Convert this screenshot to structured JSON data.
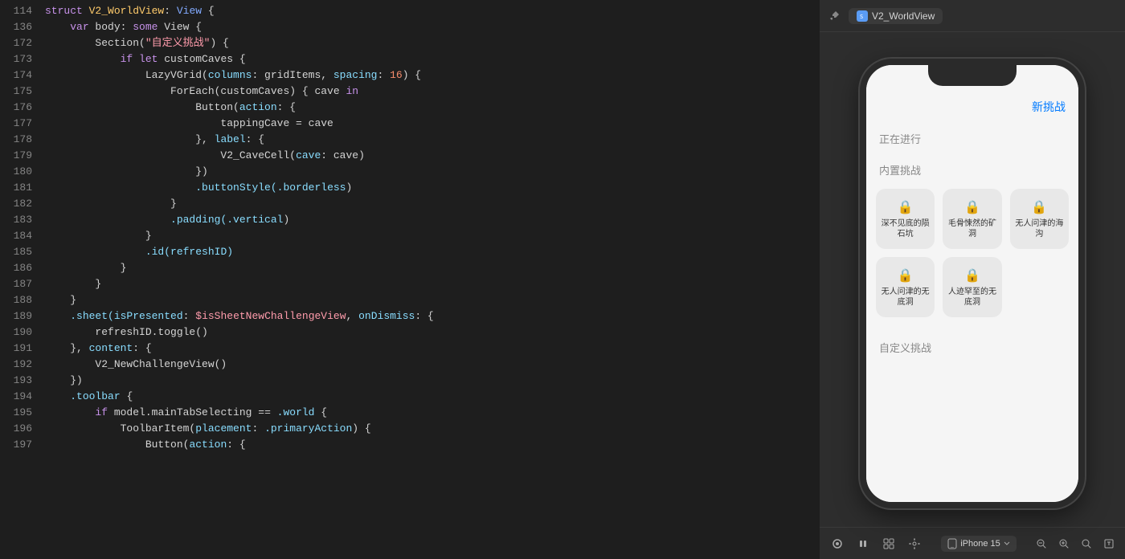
{
  "editor": {
    "lines": [
      {
        "num": "114",
        "content": [
          {
            "text": "struct ",
            "cls": "kw-keyword"
          },
          {
            "text": "V2_WorldView",
            "cls": "kw-struct"
          },
          {
            "text": ": ",
            "cls": "plain"
          },
          {
            "text": "View",
            "cls": "kw-type"
          },
          {
            "text": " {",
            "cls": "plain"
          }
        ]
      },
      {
        "num": "136",
        "content": [
          {
            "text": "    ",
            "cls": "plain"
          },
          {
            "text": "var",
            "cls": "kw-keyword"
          },
          {
            "text": " body: ",
            "cls": "plain"
          },
          {
            "text": "some",
            "cls": "kw-keyword"
          },
          {
            "text": " View {",
            "cls": "plain"
          }
        ]
      },
      {
        "num": "172",
        "content": [
          {
            "text": "        Section(",
            "cls": "plain"
          },
          {
            "text": "\"自定义挑战\"",
            "cls": "kw-string"
          },
          {
            "text": ") {",
            "cls": "plain"
          }
        ]
      },
      {
        "num": "173",
        "content": [
          {
            "text": "            ",
            "cls": "plain"
          },
          {
            "text": "if",
            "cls": "kw-keyword"
          },
          {
            "text": " ",
            "cls": "plain"
          },
          {
            "text": "let",
            "cls": "kw-keyword"
          },
          {
            "text": " customCaves {",
            "cls": "plain"
          }
        ]
      },
      {
        "num": "174",
        "content": [
          {
            "text": "                LazyVGrid(",
            "cls": "plain"
          },
          {
            "text": "columns",
            "cls": "kw-param"
          },
          {
            "text": ": gridItems, ",
            "cls": "plain"
          },
          {
            "text": "spacing",
            "cls": "kw-param"
          },
          {
            "text": ": ",
            "cls": "plain"
          },
          {
            "text": "16",
            "cls": "kw-number"
          },
          {
            "text": ") {",
            "cls": "plain"
          }
        ]
      },
      {
        "num": "175",
        "content": [
          {
            "text": "                    ForEach(customCaves) { cave ",
            "cls": "plain"
          },
          {
            "text": "in",
            "cls": "kw-keyword"
          },
          {
            "text": "",
            "cls": "plain"
          }
        ]
      },
      {
        "num": "176",
        "content": [
          {
            "text": "                        Button(",
            "cls": "plain"
          },
          {
            "text": "action",
            "cls": "kw-param"
          },
          {
            "text": ": {",
            "cls": "plain"
          }
        ]
      },
      {
        "num": "177",
        "content": [
          {
            "text": "                            tappingCave = cave",
            "cls": "plain"
          }
        ]
      },
      {
        "num": "178",
        "content": [
          {
            "text": "                        }, ",
            "cls": "plain"
          },
          {
            "text": "label",
            "cls": "kw-param"
          },
          {
            "text": ": {",
            "cls": "plain"
          }
        ]
      },
      {
        "num": "179",
        "content": [
          {
            "text": "                            V2_CaveCell(",
            "cls": "plain"
          },
          {
            "text": "cave",
            "cls": "kw-param"
          },
          {
            "text": ": cave)",
            "cls": "plain"
          }
        ]
      },
      {
        "num": "180",
        "content": [
          {
            "text": "                        })",
            "cls": "plain"
          }
        ]
      },
      {
        "num": "181",
        "content": [
          {
            "text": "                        ",
            "cls": "plain"
          },
          {
            "text": ".buttonStyle(",
            "cls": "kw-modifier"
          },
          {
            "text": ".borderless",
            "cls": "kw-modifier"
          },
          {
            "text": ")",
            "cls": "plain"
          }
        ]
      },
      {
        "num": "182",
        "content": [
          {
            "text": "                    }",
            "cls": "plain"
          }
        ]
      },
      {
        "num": "183",
        "content": [
          {
            "text": "                    ",
            "cls": "plain"
          },
          {
            "text": ".padding(",
            "cls": "kw-modifier"
          },
          {
            "text": ".vertical",
            "cls": "kw-modifier"
          },
          {
            "text": ")",
            "cls": "plain"
          }
        ]
      },
      {
        "num": "184",
        "content": [
          {
            "text": "                }",
            "cls": "plain"
          }
        ]
      },
      {
        "num": "185",
        "content": [
          {
            "text": "                ",
            "cls": "plain"
          },
          {
            "text": ".id(refreshID)",
            "cls": "kw-modifier"
          }
        ]
      },
      {
        "num": "186",
        "content": [
          {
            "text": "            }",
            "cls": "plain"
          }
        ]
      },
      {
        "num": "187",
        "content": [
          {
            "text": "        }",
            "cls": "plain"
          }
        ]
      },
      {
        "num": "188",
        "content": [
          {
            "text": "    }",
            "cls": "plain"
          }
        ]
      },
      {
        "num": "189",
        "content": [
          {
            "text": "    ",
            "cls": "plain"
          },
          {
            "text": ".sheet(",
            "cls": "kw-modifier"
          },
          {
            "text": "isPresented",
            "cls": "kw-param"
          },
          {
            "text": ": ",
            "cls": "plain"
          },
          {
            "text": "$isSheetNewChallengeView",
            "cls": "kw-string"
          },
          {
            "text": ", ",
            "cls": "plain"
          },
          {
            "text": "onDismiss",
            "cls": "kw-param"
          },
          {
            "text": ": {",
            "cls": "plain"
          }
        ]
      },
      {
        "num": "190",
        "content": [
          {
            "text": "        refreshID.toggle()",
            "cls": "plain"
          }
        ]
      },
      {
        "num": "191",
        "content": [
          {
            "text": "    }, ",
            "cls": "plain"
          },
          {
            "text": "content",
            "cls": "kw-param"
          },
          {
            "text": ": {",
            "cls": "plain"
          }
        ]
      },
      {
        "num": "192",
        "content": [
          {
            "text": "        V2_NewChallengeView()",
            "cls": "plain"
          }
        ]
      },
      {
        "num": "193",
        "content": [
          {
            "text": "    })",
            "cls": "plain"
          }
        ]
      },
      {
        "num": "194",
        "content": [
          {
            "text": "    ",
            "cls": "plain"
          },
          {
            "text": ".toolbar",
            "cls": "kw-modifier"
          },
          {
            "text": " {",
            "cls": "plain"
          }
        ]
      },
      {
        "num": "195",
        "content": [
          {
            "text": "        ",
            "cls": "plain"
          },
          {
            "text": "if",
            "cls": "kw-keyword"
          },
          {
            "text": " model.mainTabSelecting == ",
            "cls": "plain"
          },
          {
            "text": ".world",
            "cls": "kw-modifier"
          },
          {
            "text": " {",
            "cls": "plain"
          }
        ]
      },
      {
        "num": "196",
        "content": [
          {
            "text": "            ToolbarItem(",
            "cls": "plain"
          },
          {
            "text": "placement",
            "cls": "kw-param"
          },
          {
            "text": ": ",
            "cls": "plain"
          },
          {
            "text": ".primaryAction",
            "cls": "kw-modifier"
          },
          {
            "text": ") {",
            "cls": "plain"
          }
        ]
      },
      {
        "num": "197",
        "content": [
          {
            "text": "                Button(",
            "cls": "plain"
          },
          {
            "text": "action",
            "cls": "kw-param"
          },
          {
            "text": ": {",
            "cls": "plain"
          }
        ]
      }
    ]
  },
  "preview": {
    "toolbar": {
      "pin_icon": "📌",
      "tab_label": "V2_WorldView"
    },
    "app": {
      "nav_button": "新挑战",
      "section_in_progress": "正在进行",
      "section_builtin": "内置挑战",
      "section_custom": "自定义挑战",
      "caves_builtin": [
        {
          "name": "深不见底的陨石坑",
          "locked": true
        },
        {
          "name": "毛骨悚然的矿洞",
          "locked": true
        },
        {
          "name": "无人问津的海沟",
          "locked": true
        },
        {
          "name": "无人问津的无底洞",
          "locked": true
        },
        {
          "name": "人迹罕至的无底洞",
          "locked": true
        }
      ]
    },
    "bottom_bar": {
      "device_label": "iPhone 15",
      "iphone_text": "iPhone"
    }
  }
}
